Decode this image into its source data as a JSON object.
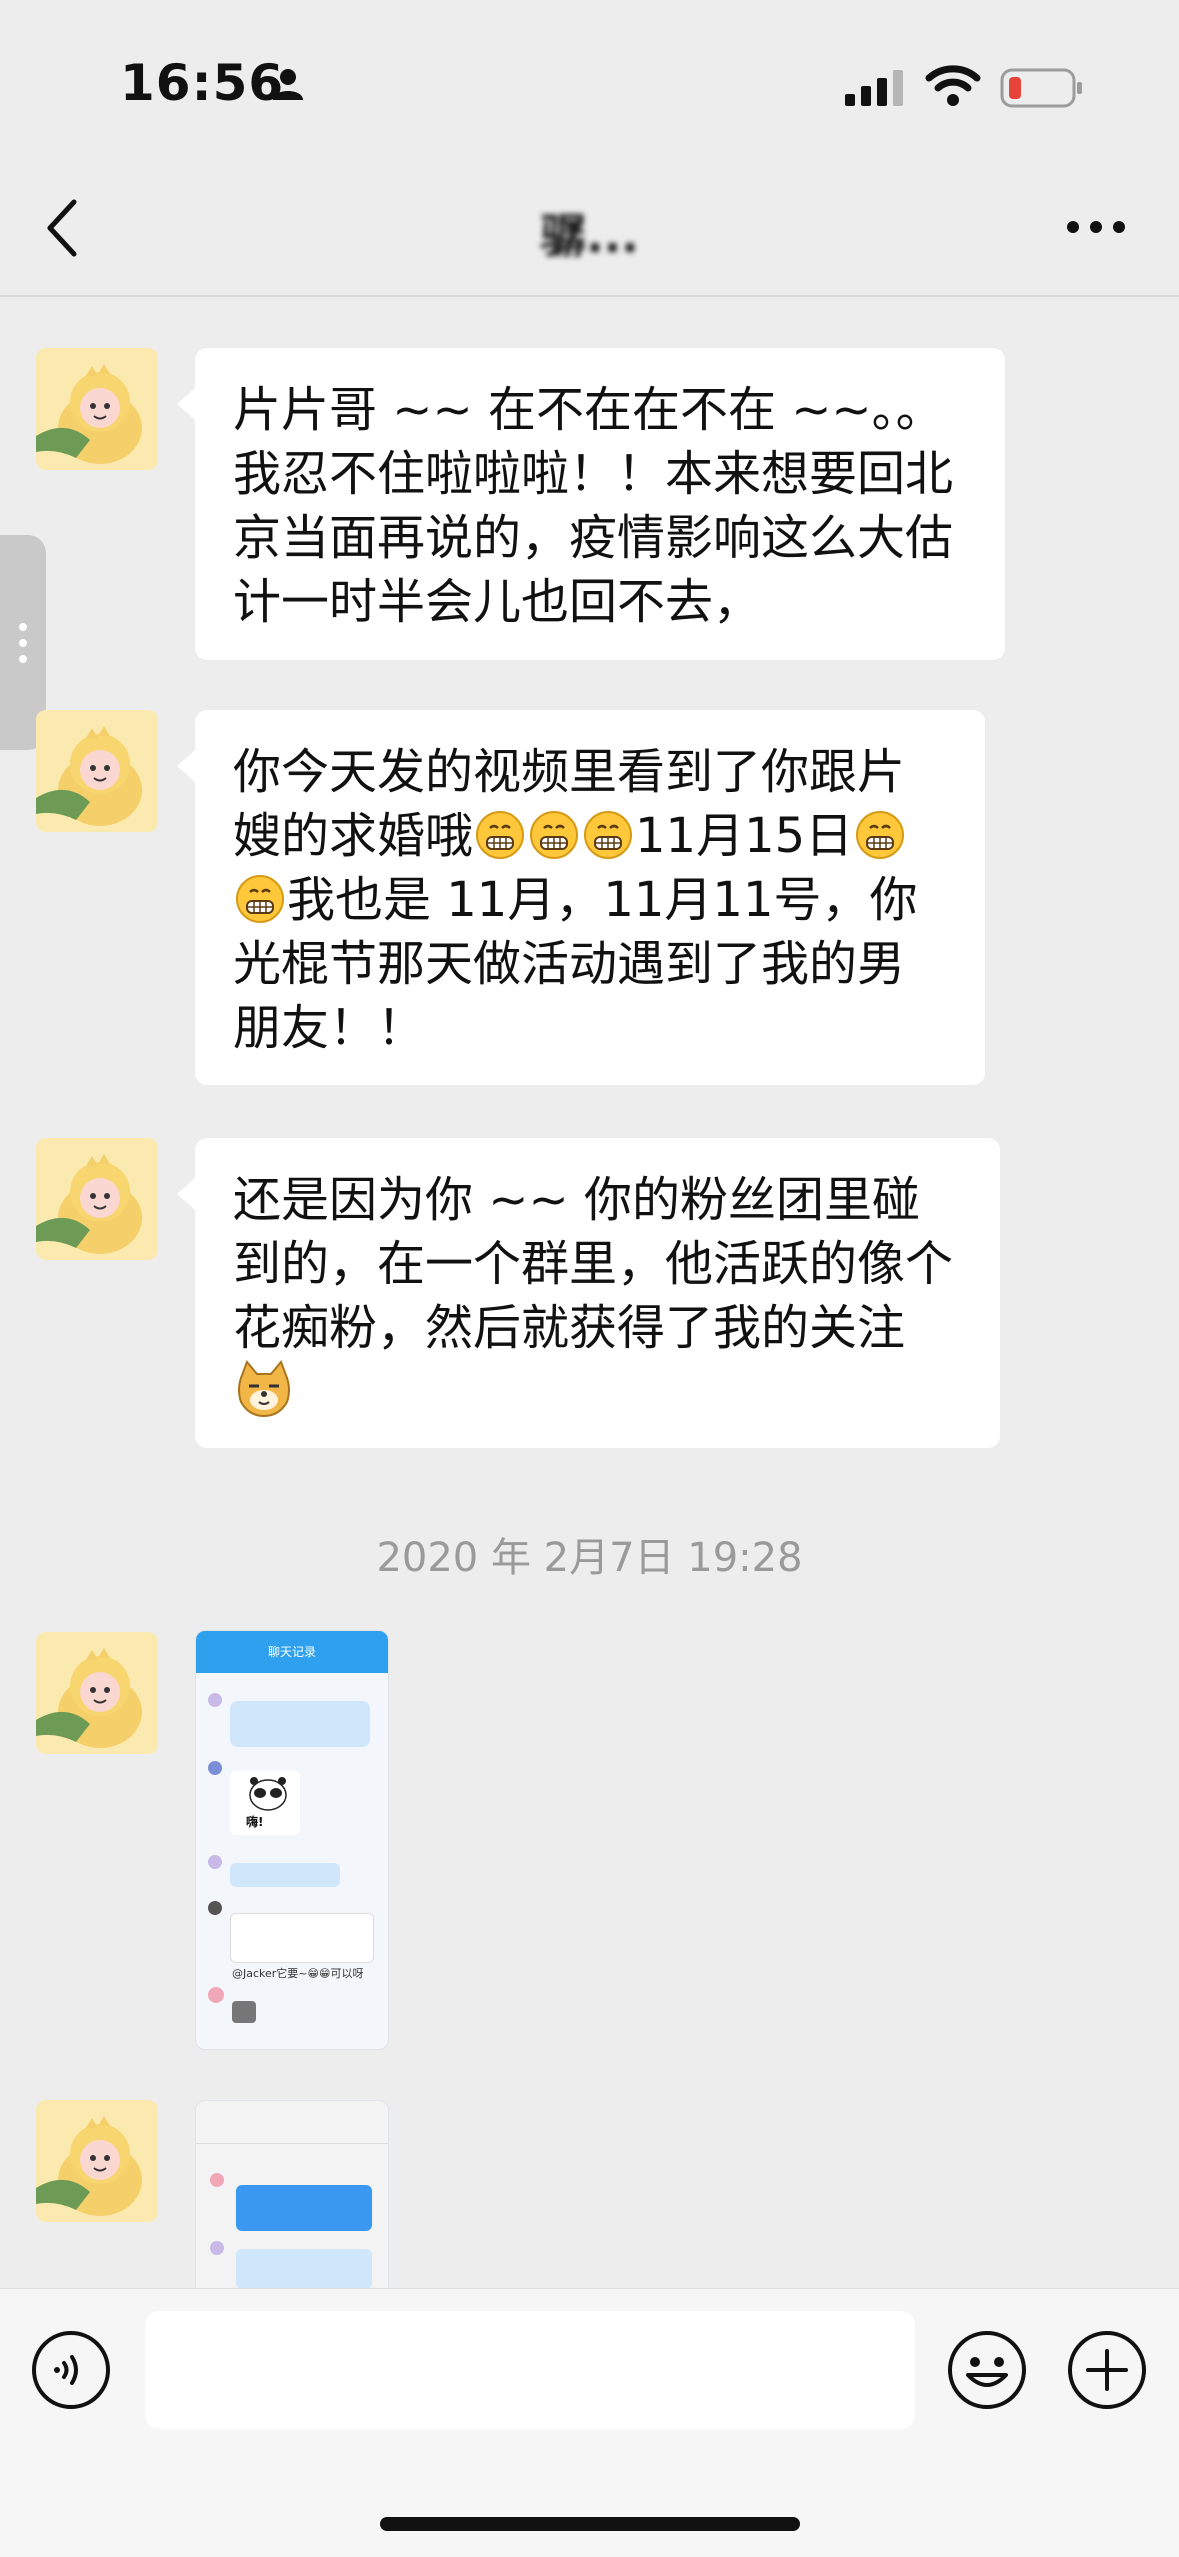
{
  "status_bar": {
    "time": "16:56",
    "battery_color": "#e8433a"
  },
  "nav": {
    "title": "骣...",
    "back_icon": "chevron-left-icon",
    "more_icon": "more-dots-icon"
  },
  "messages": [
    {
      "text_parts": [
        "片片哥 ~~ 在不在在不在 ~~。。我忍不住啦啦啦！！本来想要回北京当面再说的，疫情影响这么大估计一时半会儿也回不去，"
      ]
    },
    {
      "text_parts": [
        "你今天发的视频里看到了你跟片嫂的求婚哦",
        "11月15日",
        "我也是 11月，11月11号，你光棍节那天做活动遇到了我的男朋友！！"
      ]
    },
    {
      "text_parts": [
        "还是因为你 ~~ 你的粉丝团里碰到的，在一个群里，他活跃的像个花痴粉，然后就获得了我的关注"
      ]
    }
  ],
  "timestamp": "2020 年 2月7日 19:28",
  "image_messages": [
    {
      "header": "聊天记录",
      "caption": "嗨!",
      "snippet": "@Jacker它要~😁😁可以呀"
    },
    {
      "header": "",
      "caption": "",
      "snippet": ""
    }
  ],
  "input": {
    "placeholder": ""
  },
  "icons": {
    "voice": "voice-icon",
    "emoji": "emoji-icon",
    "plus": "plus-icon"
  }
}
